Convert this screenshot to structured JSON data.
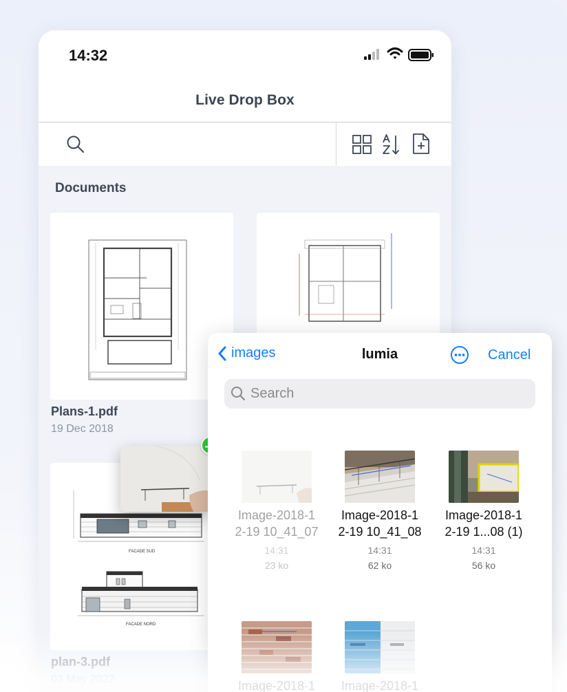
{
  "status_bar": {
    "time": "14:32"
  },
  "nav": {
    "title": "Live Drop Box"
  },
  "toolbar": {
    "search_icon": "search-icon",
    "grid_icon": "grid-view-icon",
    "sort_icon": "sort-az-icon",
    "add_icon": "add-document-icon"
  },
  "section": {
    "title": "Documents"
  },
  "documents": [
    {
      "name": "Plans-1.pdf",
      "date": "19 Dec 2018"
    },
    {
      "name": "",
      "date": ""
    },
    {
      "name": "plan-3.pdf",
      "date": "03 May 2022"
    }
  ],
  "picker": {
    "back_label": "images",
    "title": "lumia",
    "cancel_label": "Cancel",
    "search_placeholder": "Search",
    "files": [
      {
        "name_line1": "Image-2018-1",
        "name_line2": "2-19 10_41_07",
        "time": "14:31",
        "size": "23 ko"
      },
      {
        "name_line1": "Image-2018-1",
        "name_line2": "2-19 10_41_08",
        "time": "14:31",
        "size": "62 ko"
      },
      {
        "name_line1": "Image-2018-1",
        "name_line2": "2-19 1...08 (1)",
        "time": "14:31",
        "size": "56 ko"
      },
      {
        "name_line1": "Image-2018-1",
        "name_line2": "",
        "time": "",
        "size": ""
      },
      {
        "name_line1": "Image-2018-1",
        "name_line2": "",
        "time": "",
        "size": ""
      }
    ]
  },
  "colors": {
    "accent": "#157efb",
    "add_badge": "#34c738",
    "text_dark": "#3e4757"
  }
}
